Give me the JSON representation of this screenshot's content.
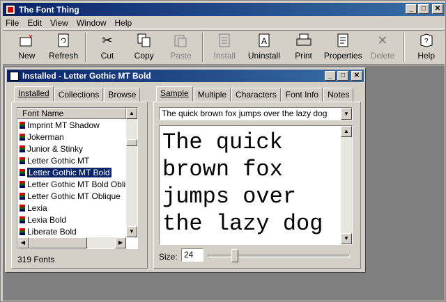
{
  "app": {
    "title": "The Font Thing",
    "window_buttons": {
      "minimize": "_",
      "maximize": "□",
      "close": "✕"
    }
  },
  "menu": {
    "items": [
      "File",
      "Edit",
      "View",
      "Window",
      "Help"
    ]
  },
  "toolbar": {
    "buttons": [
      {
        "label": "New",
        "icon": "new-folder-icon",
        "enabled": true
      },
      {
        "label": "Refresh",
        "icon": "refresh-icon",
        "enabled": true
      },
      {
        "label": "Cut",
        "icon": "scissors-icon",
        "enabled": true
      },
      {
        "label": "Copy",
        "icon": "copy-icon",
        "enabled": true
      },
      {
        "label": "Paste",
        "icon": "paste-icon",
        "enabled": false
      },
      {
        "label": "Install",
        "icon": "install-icon",
        "enabled": false
      },
      {
        "label": "Uninstall",
        "icon": "uninstall-icon",
        "enabled": true
      },
      {
        "label": "Print",
        "icon": "printer-icon",
        "enabled": true
      },
      {
        "label": "Properties",
        "icon": "properties-icon",
        "enabled": true
      },
      {
        "label": "Delete",
        "icon": "delete-x-icon",
        "enabled": false
      },
      {
        "label": "Help",
        "icon": "help-book-icon",
        "enabled": true
      }
    ]
  },
  "child_window": {
    "title": "Installed - Letter Gothic MT Bold",
    "left_tabs": [
      "Installed",
      "Collections",
      "Browse"
    ],
    "list_header": "Font Name",
    "fonts": [
      "Imprint MT Shadow",
      "Jokerman",
      "Junior & Stinky",
      "Letter Gothic MT",
      "Letter Gothic MT Bold",
      "Letter Gothic MT Bold Obli...",
      "Letter Gothic MT Oblique",
      "Lexia",
      "Lexia Bold",
      "Liberate Bold"
    ],
    "selected_font": "Letter Gothic MT Bold",
    "font_count": "319 Fonts",
    "right_tabs": [
      "Sample",
      "Multiple",
      "Characters",
      "Font Info",
      "Notes"
    ],
    "sample_combo": "The quick brown fox jumps over the lazy dog",
    "preview_lines": [
      "The quick",
      "brown fox",
      "jumps over",
      "the lazy dog"
    ],
    "size_label": "Size:",
    "size_value": "24"
  }
}
